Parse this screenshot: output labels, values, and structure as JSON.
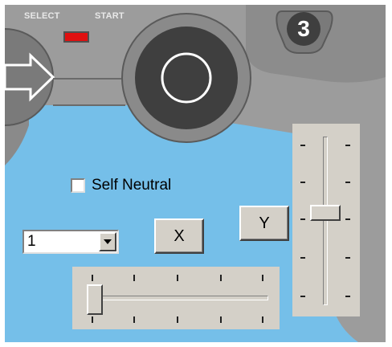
{
  "controller": {
    "select_label": "SELECT",
    "start_label": "START",
    "player_number": "3"
  },
  "self_neutral": {
    "label": "Self Neutral",
    "checked": false
  },
  "combo": {
    "value": "1"
  },
  "buttons": {
    "x_label": "X",
    "y_label": "Y"
  },
  "horizontal_slider": {
    "level": 0.0,
    "tick_count": 5
  },
  "vertical_slider": {
    "level": 0.5,
    "tick_count": 6
  },
  "colors": {
    "background": "#75bfe9",
    "controller_body": "#9c9c9c",
    "controller_dark": "#3f3f3f",
    "select_led": "#e01010",
    "control_face": "#d4d0c8"
  }
}
